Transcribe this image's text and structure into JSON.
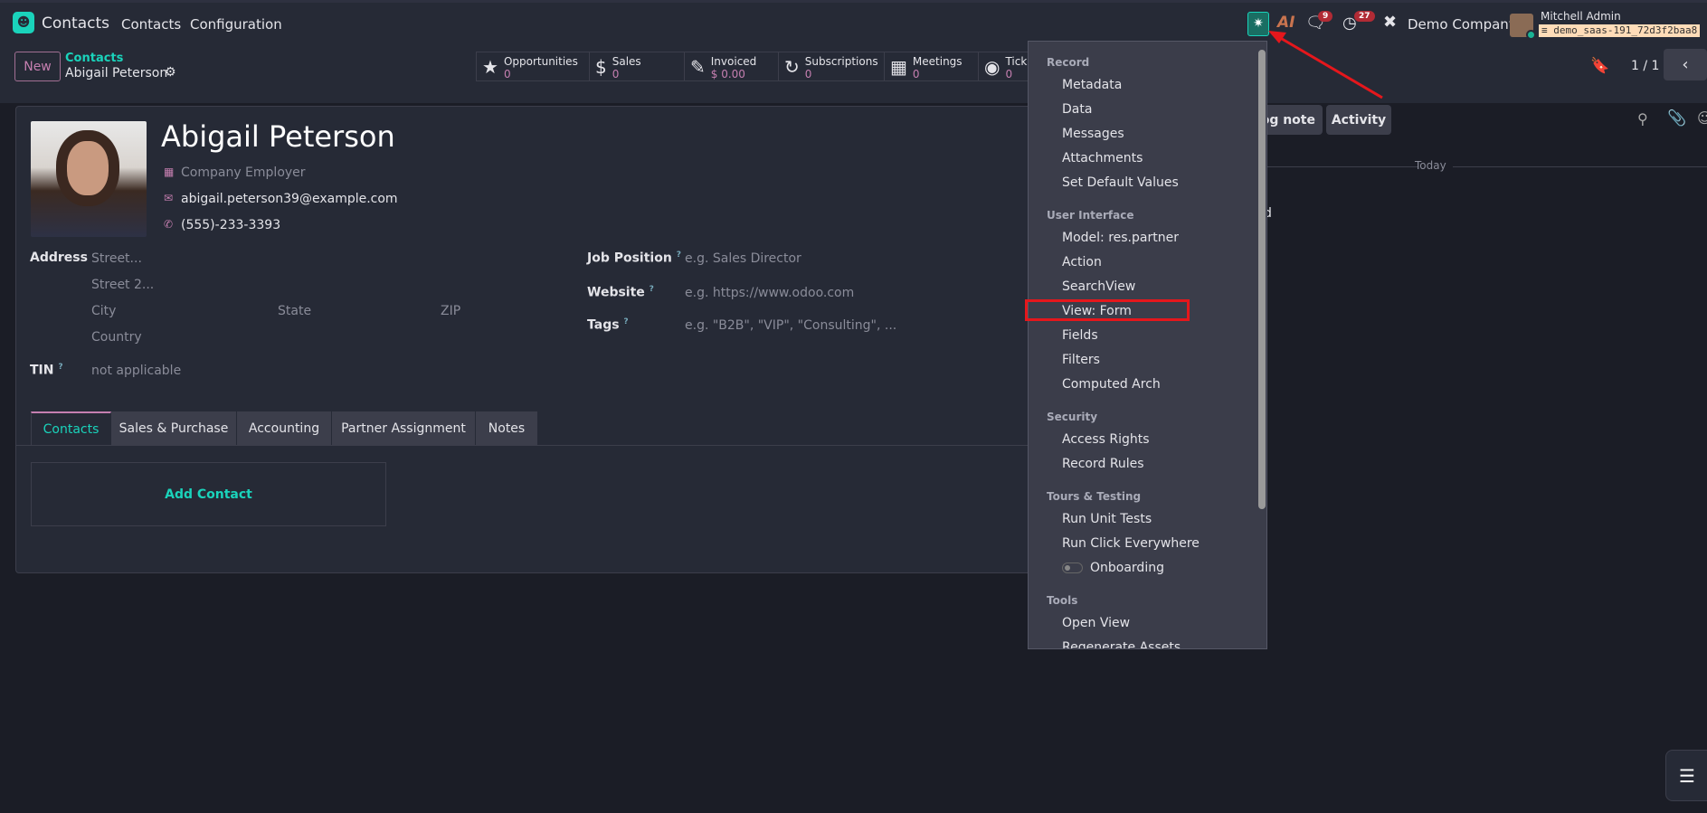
{
  "navbar": {
    "app_name": "Contacts",
    "menu": [
      "Contacts",
      "Configuration"
    ],
    "chat_count": "9",
    "activity_count": "27",
    "company": "Demo Company",
    "user_name": "Mitchell Admin",
    "database": "demo_saas-191_72d3f2baa8"
  },
  "control_panel": {
    "new_label": "New",
    "breadcrumb_parent": "Contacts",
    "breadcrumb_current": "Abigail Peterson",
    "pager": "1 / 1"
  },
  "stats": [
    {
      "label": "Opportunities",
      "value": "0"
    },
    {
      "label": "Sales",
      "value": "0"
    },
    {
      "label": "Invoiced",
      "value": "$ 0.00"
    },
    {
      "label": "Subscriptions",
      "value": "0"
    },
    {
      "label": "Meetings",
      "value": "0"
    },
    {
      "label": "Tick",
      "value": "0"
    }
  ],
  "form": {
    "name": "Abigail Peterson",
    "company_placeholder": "Company Employer",
    "email": "abigail.peterson39@example.com",
    "phone": "(555)-233-3393",
    "address_label": "Address",
    "street_ph": "Street...",
    "street2_ph": "Street 2...",
    "city_ph": "City",
    "state_ph": "State",
    "zip_ph": "ZIP",
    "country_ph": "Country",
    "tin_label": "TIN",
    "tin_value": "not applicable",
    "q": "?",
    "job_label": "Job Position",
    "job_ph": "e.g. Sales Director",
    "website_label": "Website",
    "website_ph": "e.g. https://www.odoo.com",
    "tags_label": "Tags",
    "tags_ph": "e.g. \"B2B\", \"VIP\", \"Consulting\", ...",
    "tabs": [
      "Contacts",
      "Sales & Purchase",
      "Accounting",
      "Partner Assignment",
      "Notes"
    ],
    "add_contact": "Add Contact"
  },
  "chatter": {
    "log_note": "Log note",
    "activity": "Activity",
    "today": "Today",
    "partial": "d"
  },
  "debug_menu": {
    "sections": [
      {
        "title": "Record",
        "items": [
          "Metadata",
          "Data",
          "Messages",
          "Attachments",
          "Set Default Values"
        ]
      },
      {
        "title": "User Interface",
        "items": [
          "Model: res.partner",
          "Action",
          "SearchView",
          "View: Form",
          "Fields",
          "Filters",
          "Computed Arch"
        ]
      },
      {
        "title": "Security",
        "items": [
          "Access Rights",
          "Record Rules"
        ]
      },
      {
        "title": "Tours & Testing",
        "items": [
          "Run Unit Tests",
          "Run Click Everywhere",
          "Onboarding"
        ]
      },
      {
        "title": "Tools",
        "items": [
          "Open View",
          "Regenerate Assets"
        ]
      }
    ]
  },
  "colors": {
    "accent": "#1ad3bb",
    "highlight": "#e5171c",
    "badge": "#b12b35"
  }
}
